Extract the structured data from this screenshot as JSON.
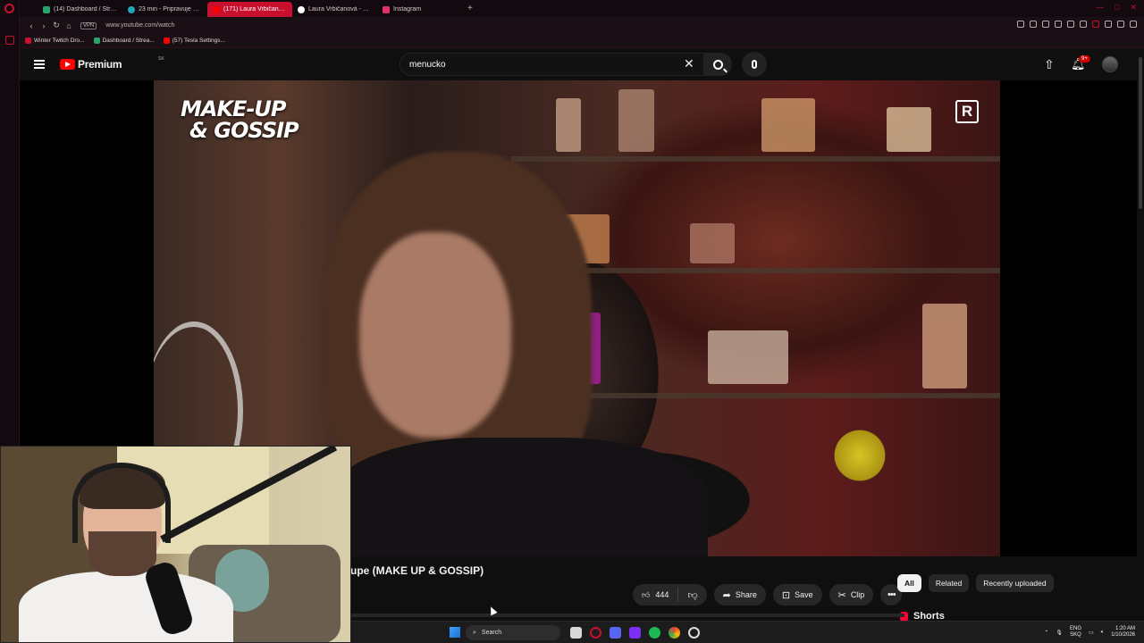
{
  "browser": {
    "tabs": [
      {
        "label": "(14) Dashboard / Streamla",
        "favicon_color": "#29a36a"
      },
      {
        "label": "23 min - Pripravuje sa | W",
        "favicon_color": "#1ea7b8"
      },
      {
        "label": "(171) Laura Vrbičanová -",
        "favicon_color": "#ff0000",
        "active": true
      },
      {
        "label": "Laura Vrbičanová - Hľada",
        "favicon_color": "#ffffff"
      },
      {
        "label": "Instagram",
        "favicon_color": "#e1306c"
      }
    ],
    "new_tab": "+",
    "url": "www.youtube.com/watch",
    "vpn_label": "VPN",
    "bookmarks": [
      {
        "label": "Winter Twitch Dro...",
        "favicon_color": "#c8102e"
      },
      {
        "label": "Dashboard / Strea...",
        "favicon_color": "#29a36a"
      },
      {
        "label": "(57) Tesla Settings...",
        "favicon_color": "#ff0000"
      }
    ]
  },
  "youtube": {
    "logo_text": "Premium",
    "country_code": "SK",
    "search_value": "menucko",
    "notification_badge": "9+"
  },
  "video": {
    "brand_line1": "MAKE-UP",
    "brand_line2": "& GOSSIP",
    "channel_logo_letter": "R",
    "title": "upe (MAKE UP & GOSSIP)"
  },
  "actions": {
    "likes": "444",
    "share": "Share",
    "save": "Save",
    "clip": "Clip",
    "more": "•••"
  },
  "chips": [
    {
      "label": "All",
      "selected": true
    },
    {
      "label": "Related",
      "selected": false
    },
    {
      "label": "Recently uploaded",
      "selected": false
    }
  ],
  "sidebar_section": "Shorts",
  "taskbar": {
    "search_placeholder": "Search",
    "lang_line1": "ENG",
    "lang_line2": "SKQ",
    "time": "1:20 AM",
    "date": "1/10/2026"
  }
}
